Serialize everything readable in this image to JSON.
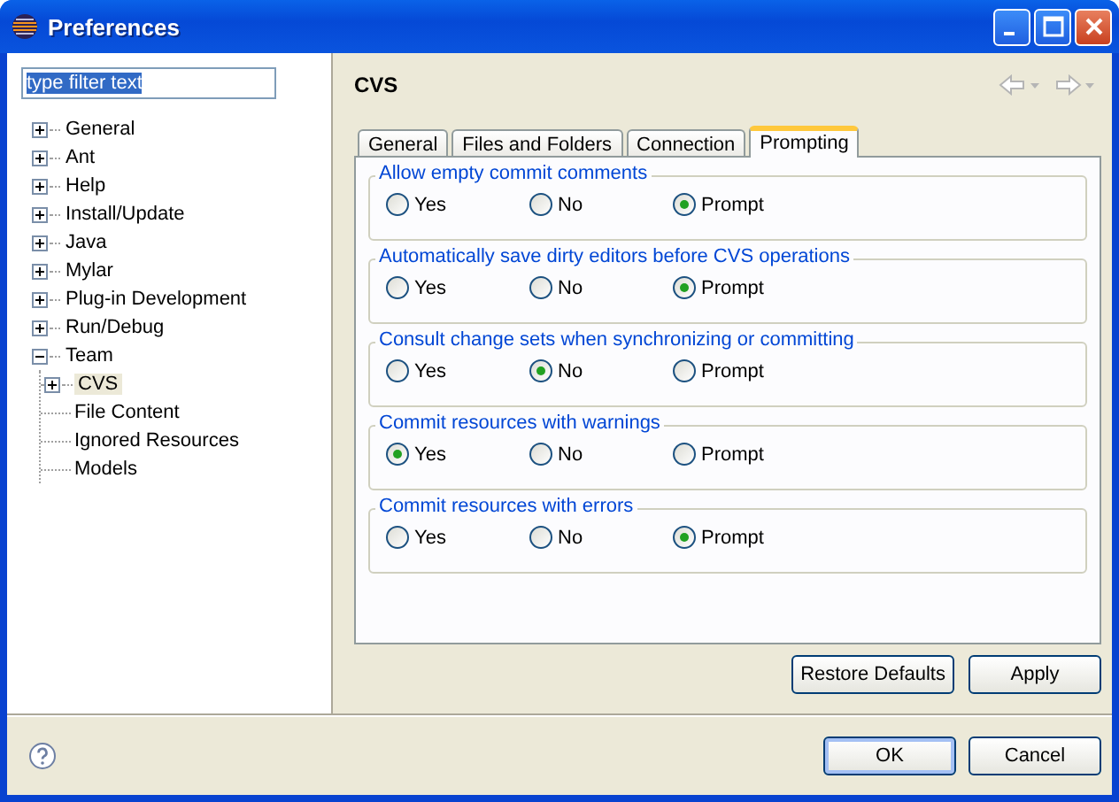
{
  "window": {
    "title": "Preferences"
  },
  "filter": {
    "value": "type filter text",
    "text_selected": true
  },
  "tree": [
    {
      "label": "General",
      "kind": "expandable",
      "expanded": false,
      "selected": false
    },
    {
      "label": "Ant",
      "kind": "expandable",
      "expanded": false,
      "selected": false
    },
    {
      "label": "Help",
      "kind": "expandable",
      "expanded": false,
      "selected": false
    },
    {
      "label": "Install/Update",
      "kind": "expandable",
      "expanded": false,
      "selected": false
    },
    {
      "label": "Java",
      "kind": "expandable",
      "expanded": false,
      "selected": false
    },
    {
      "label": "Mylar",
      "kind": "expandable",
      "expanded": false,
      "selected": false
    },
    {
      "label": "Plug-in Development",
      "kind": "expandable",
      "expanded": false,
      "selected": false
    },
    {
      "label": "Run/Debug",
      "kind": "expandable",
      "expanded": false,
      "selected": false
    },
    {
      "label": "Team",
      "kind": "expandable",
      "expanded": true,
      "selected": false,
      "children": [
        {
          "label": "CVS",
          "kind": "expandable",
          "expanded": false,
          "selected": true
        },
        {
          "label": "File Content",
          "kind": "leaf",
          "selected": false
        },
        {
          "label": "Ignored Resources",
          "kind": "leaf",
          "selected": false
        },
        {
          "label": "Models",
          "kind": "leaf",
          "selected": false
        }
      ]
    }
  ],
  "page": {
    "title": "CVS",
    "nav": [
      {
        "kind": "back",
        "disabled": true
      },
      {
        "kind": "forward",
        "disabled": true
      }
    ]
  },
  "tabs": [
    {
      "label": "General",
      "selected": false
    },
    {
      "label": "Files and Folders",
      "selected": false
    },
    {
      "label": "Connection",
      "selected": false
    },
    {
      "label": "Prompting",
      "selected": true
    }
  ],
  "groups": [
    {
      "title": "Allow empty commit comments",
      "options": [
        {
          "label": "Yes",
          "selected": false
        },
        {
          "label": "No",
          "selected": false
        },
        {
          "label": "Prompt",
          "selected": true
        }
      ]
    },
    {
      "title": "Automatically save dirty editors before CVS operations",
      "options": [
        {
          "label": "Yes",
          "selected": false
        },
        {
          "label": "No",
          "selected": false
        },
        {
          "label": "Prompt",
          "selected": true
        }
      ]
    },
    {
      "title": "Consult change sets when synchronizing or committing",
      "options": [
        {
          "label": "Yes",
          "selected": false
        },
        {
          "label": "No",
          "selected": true
        },
        {
          "label": "Prompt",
          "selected": false
        }
      ]
    },
    {
      "title": "Commit resources with warnings",
      "options": [
        {
          "label": "Yes",
          "selected": true
        },
        {
          "label": "No",
          "selected": false
        },
        {
          "label": "Prompt",
          "selected": false
        }
      ]
    },
    {
      "title": "Commit resources with errors",
      "options": [
        {
          "label": "Yes",
          "selected": false
        },
        {
          "label": "No",
          "selected": false
        },
        {
          "label": "Prompt",
          "selected": true
        }
      ]
    }
  ],
  "page_buttons": [
    {
      "label": "Restore Defaults"
    },
    {
      "label": "Apply"
    }
  ],
  "footer_buttons": [
    {
      "label": "OK",
      "default": true
    },
    {
      "label": "Cancel",
      "default": false
    }
  ]
}
